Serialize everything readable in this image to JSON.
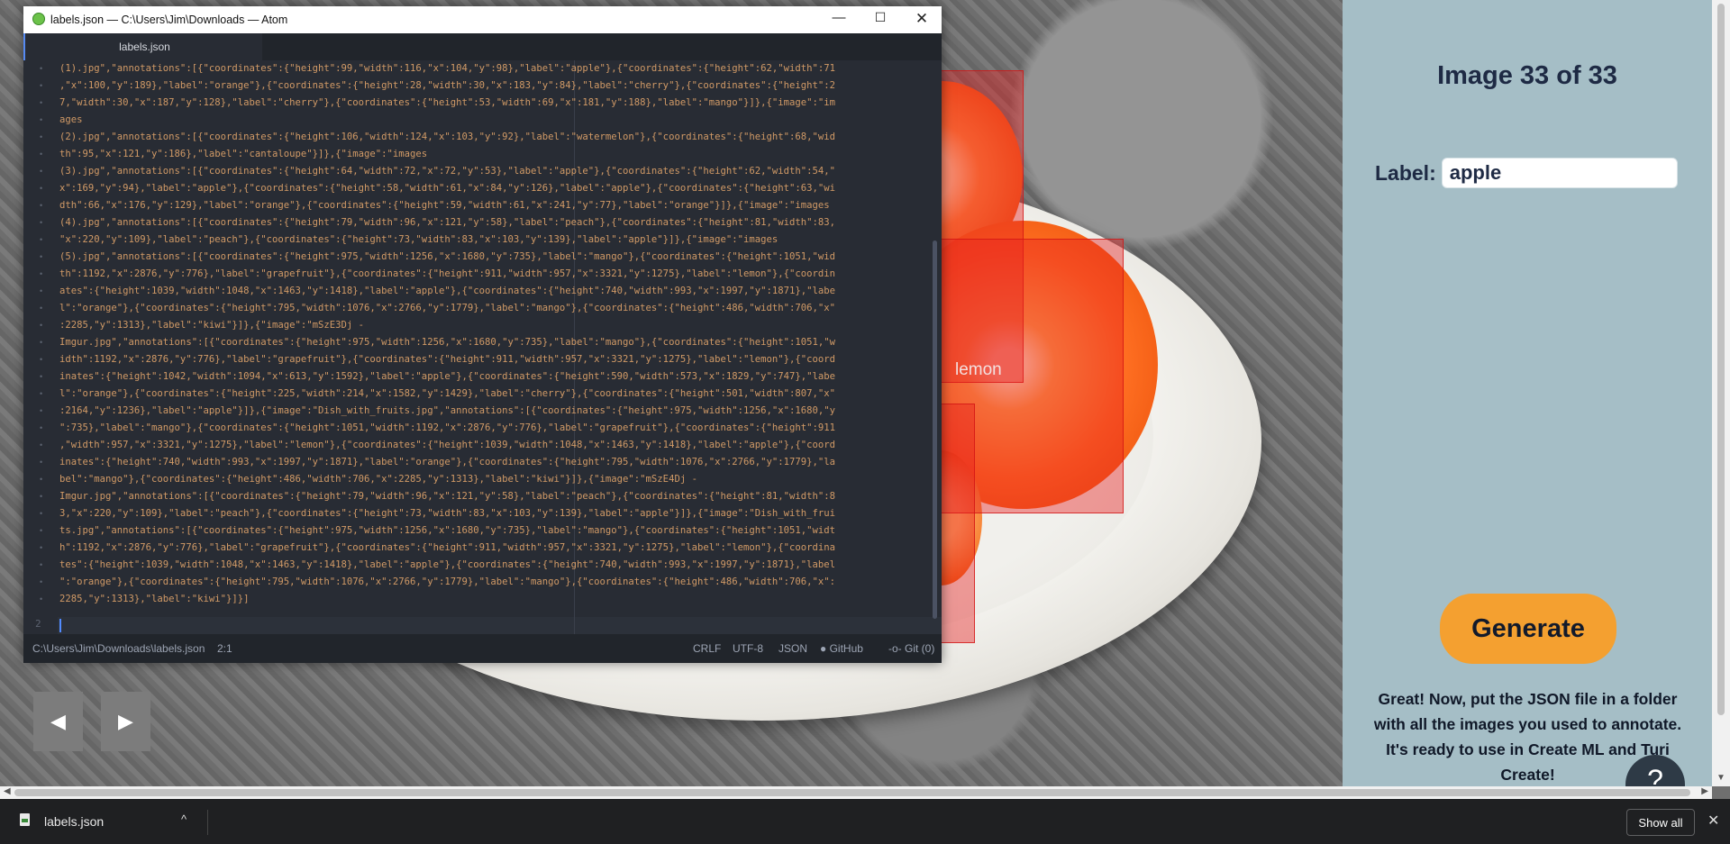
{
  "window": {
    "title": "labels.json — C:\\Users\\Jim\\Downloads — Atom",
    "controls": {
      "minimize": "—",
      "maximize": "☐",
      "close": "✕"
    }
  },
  "editor": {
    "tab_title": "labels.json",
    "code_lines": [
      "(1).jpg\",\"annotations\":[{\"coordinates\":{\"height\":99,\"width\":116,\"x\":104,\"y\":98},\"label\":\"apple\"},{\"coordinates\":{\"height\":62,\"width\":71",
      ",\"x\":100,\"y\":189},\"label\":\"orange\"},{\"coordinates\":{\"height\":28,\"width\":30,\"x\":183,\"y\":84},\"label\":\"cherry\"},{\"coordinates\":{\"height\":2",
      "7,\"width\":30,\"x\":187,\"y\":128},\"label\":\"cherry\"},{\"coordinates\":{\"height\":53,\"width\":69,\"x\":181,\"y\":188},\"label\":\"mango\"}]},{\"image\":\"im",
      "ages",
      "(2).jpg\",\"annotations\":[{\"coordinates\":{\"height\":106,\"width\":124,\"x\":103,\"y\":92},\"label\":\"watermelon\"},{\"coordinates\":{\"height\":68,\"wid",
      "th\":95,\"x\":121,\"y\":186},\"label\":\"cantaloupe\"}]},{\"image\":\"images",
      "(3).jpg\",\"annotations\":[{\"coordinates\":{\"height\":64,\"width\":72,\"x\":72,\"y\":53},\"label\":\"apple\"},{\"coordinates\":{\"height\":62,\"width\":54,\"",
      "x\":169,\"y\":94},\"label\":\"apple\"},{\"coordinates\":{\"height\":58,\"width\":61,\"x\":84,\"y\":126},\"label\":\"apple\"},{\"coordinates\":{\"height\":63,\"wi",
      "dth\":66,\"x\":176,\"y\":129},\"label\":\"orange\"},{\"coordinates\":{\"height\":59,\"width\":61,\"x\":241,\"y\":77},\"label\":\"orange\"}]},{\"image\":\"images",
      "(4).jpg\",\"annotations\":[{\"coordinates\":{\"height\":79,\"width\":96,\"x\":121,\"y\":58},\"label\":\"peach\"},{\"coordinates\":{\"height\":81,\"width\":83,",
      "\"x\":220,\"y\":109},\"label\":\"peach\"},{\"coordinates\":{\"height\":73,\"width\":83,\"x\":103,\"y\":139},\"label\":\"apple\"}]},{\"image\":\"images",
      "(5).jpg\",\"annotations\":[{\"coordinates\":{\"height\":975,\"width\":1256,\"x\":1680,\"y\":735},\"label\":\"mango\"},{\"coordinates\":{\"height\":1051,\"wid",
      "th\":1192,\"x\":2876,\"y\":776},\"label\":\"grapefruit\"},{\"coordinates\":{\"height\":911,\"width\":957,\"x\":3321,\"y\":1275},\"label\":\"lemon\"},{\"coordin",
      "ates\":{\"height\":1039,\"width\":1048,\"x\":1463,\"y\":1418},\"label\":\"apple\"},{\"coordinates\":{\"height\":740,\"width\":993,\"x\":1997,\"y\":1871},\"labe",
      "l\":\"orange\"},{\"coordinates\":{\"height\":795,\"width\":1076,\"x\":2766,\"y\":1779},\"label\":\"mango\"},{\"coordinates\":{\"height\":486,\"width\":706,\"x\"",
      ":2285,\"y\":1313},\"label\":\"kiwi\"}]},{\"image\":\"mSzE3Dj -",
      "Imgur.jpg\",\"annotations\":[{\"coordinates\":{\"height\":975,\"width\":1256,\"x\":1680,\"y\":735},\"label\":\"mango\"},{\"coordinates\":{\"height\":1051,\"w",
      "idth\":1192,\"x\":2876,\"y\":776},\"label\":\"grapefruit\"},{\"coordinates\":{\"height\":911,\"width\":957,\"x\":3321,\"y\":1275},\"label\":\"lemon\"},{\"coord",
      "inates\":{\"height\":1042,\"width\":1094,\"x\":613,\"y\":1592},\"label\":\"apple\"},{\"coordinates\":{\"height\":590,\"width\":573,\"x\":1829,\"y\":747},\"labe",
      "l\":\"orange\"},{\"coordinates\":{\"height\":225,\"width\":214,\"x\":1582,\"y\":1429},\"label\":\"cherry\"},{\"coordinates\":{\"height\":501,\"width\":807,\"x\"",
      ":2164,\"y\":1236},\"label\":\"apple\"}]},{\"image\":\"Dish_with_fruits.jpg\",\"annotations\":[{\"coordinates\":{\"height\":975,\"width\":1256,\"x\":1680,\"y",
      "\":735},\"label\":\"mango\"},{\"coordinates\":{\"height\":1051,\"width\":1192,\"x\":2876,\"y\":776},\"label\":\"grapefruit\"},{\"coordinates\":{\"height\":911",
      ",\"width\":957,\"x\":3321,\"y\":1275},\"label\":\"lemon\"},{\"coordinates\":{\"height\":1039,\"width\":1048,\"x\":1463,\"y\":1418},\"label\":\"apple\"},{\"coord",
      "inates\":{\"height\":740,\"width\":993,\"x\":1997,\"y\":1871},\"label\":\"orange\"},{\"coordinates\":{\"height\":795,\"width\":1076,\"x\":2766,\"y\":1779},\"la",
      "bel\":\"mango\"},{\"coordinates\":{\"height\":486,\"width\":706,\"x\":2285,\"y\":1313},\"label\":\"kiwi\"}]},{\"image\":\"mSzE4Dj -",
      "Imgur.jpg\",\"annotations\":[{\"coordinates\":{\"height\":79,\"width\":96,\"x\":121,\"y\":58},\"label\":\"peach\"},{\"coordinates\":{\"height\":81,\"width\":8",
      "3,\"x\":220,\"y\":109},\"label\":\"peach\"},{\"coordinates\":{\"height\":73,\"width\":83,\"x\":103,\"y\":139},\"label\":\"apple\"}]},{\"image\":\"Dish_with_frui",
      "ts.jpg\",\"annotations\":[{\"coordinates\":{\"height\":975,\"width\":1256,\"x\":1680,\"y\":735},\"label\":\"mango\"},{\"coordinates\":{\"height\":1051,\"widt",
      "h\":1192,\"x\":2876,\"y\":776},\"label\":\"grapefruit\"},{\"coordinates\":{\"height\":911,\"width\":957,\"x\":3321,\"y\":1275},\"label\":\"lemon\"},{\"coordina",
      "tes\":{\"height\":1039,\"width\":1048,\"x\":1463,\"y\":1418},\"label\":\"apple\"},{\"coordinates\":{\"height\":740,\"width\":993,\"x\":1997,\"y\":1871},\"label",
      "\":\"orange\"},{\"coordinates\":{\"height\":795,\"width\":1076,\"x\":2766,\"y\":1779},\"label\":\"mango\"},{\"coordinates\":{\"height\":486,\"width\":706,\"x\":",
      "2285,\"y\":1313},\"label\":\"kiwi\"}]}]"
    ],
    "second_line_number": "2"
  },
  "status_bar": {
    "path": "C:\\Users\\Jim\\Downloads\\labels.json",
    "cursor_position": "2:1",
    "line_ending": "CRLF",
    "encoding": "UTF-8",
    "grammar": "JSON",
    "github": "GitHub",
    "git": "Git (0)"
  },
  "canvas": {
    "bbox_label": "lemon",
    "prev_label": "◀",
    "next_label": "▶"
  },
  "panel": {
    "title": "Image 33 of 33",
    "label_caption": "Label:",
    "label_value": "apple",
    "generate_label": "Generate",
    "instructions": "Great! Now, put the JSON file in a folder with all the images you used to annotate. It's ready to use in Create ML and Turi Create!",
    "help_label": "?"
  },
  "download_bar": {
    "file_name": "labels.json",
    "show_all_label": "Show all",
    "close_label": "✕",
    "chevron": "^"
  },
  "colors": {
    "accent_button": "#f4a030",
    "panel_bg": "#a5bec6",
    "bbox": "#e61e1e",
    "editor_bg": "#282c34"
  }
}
